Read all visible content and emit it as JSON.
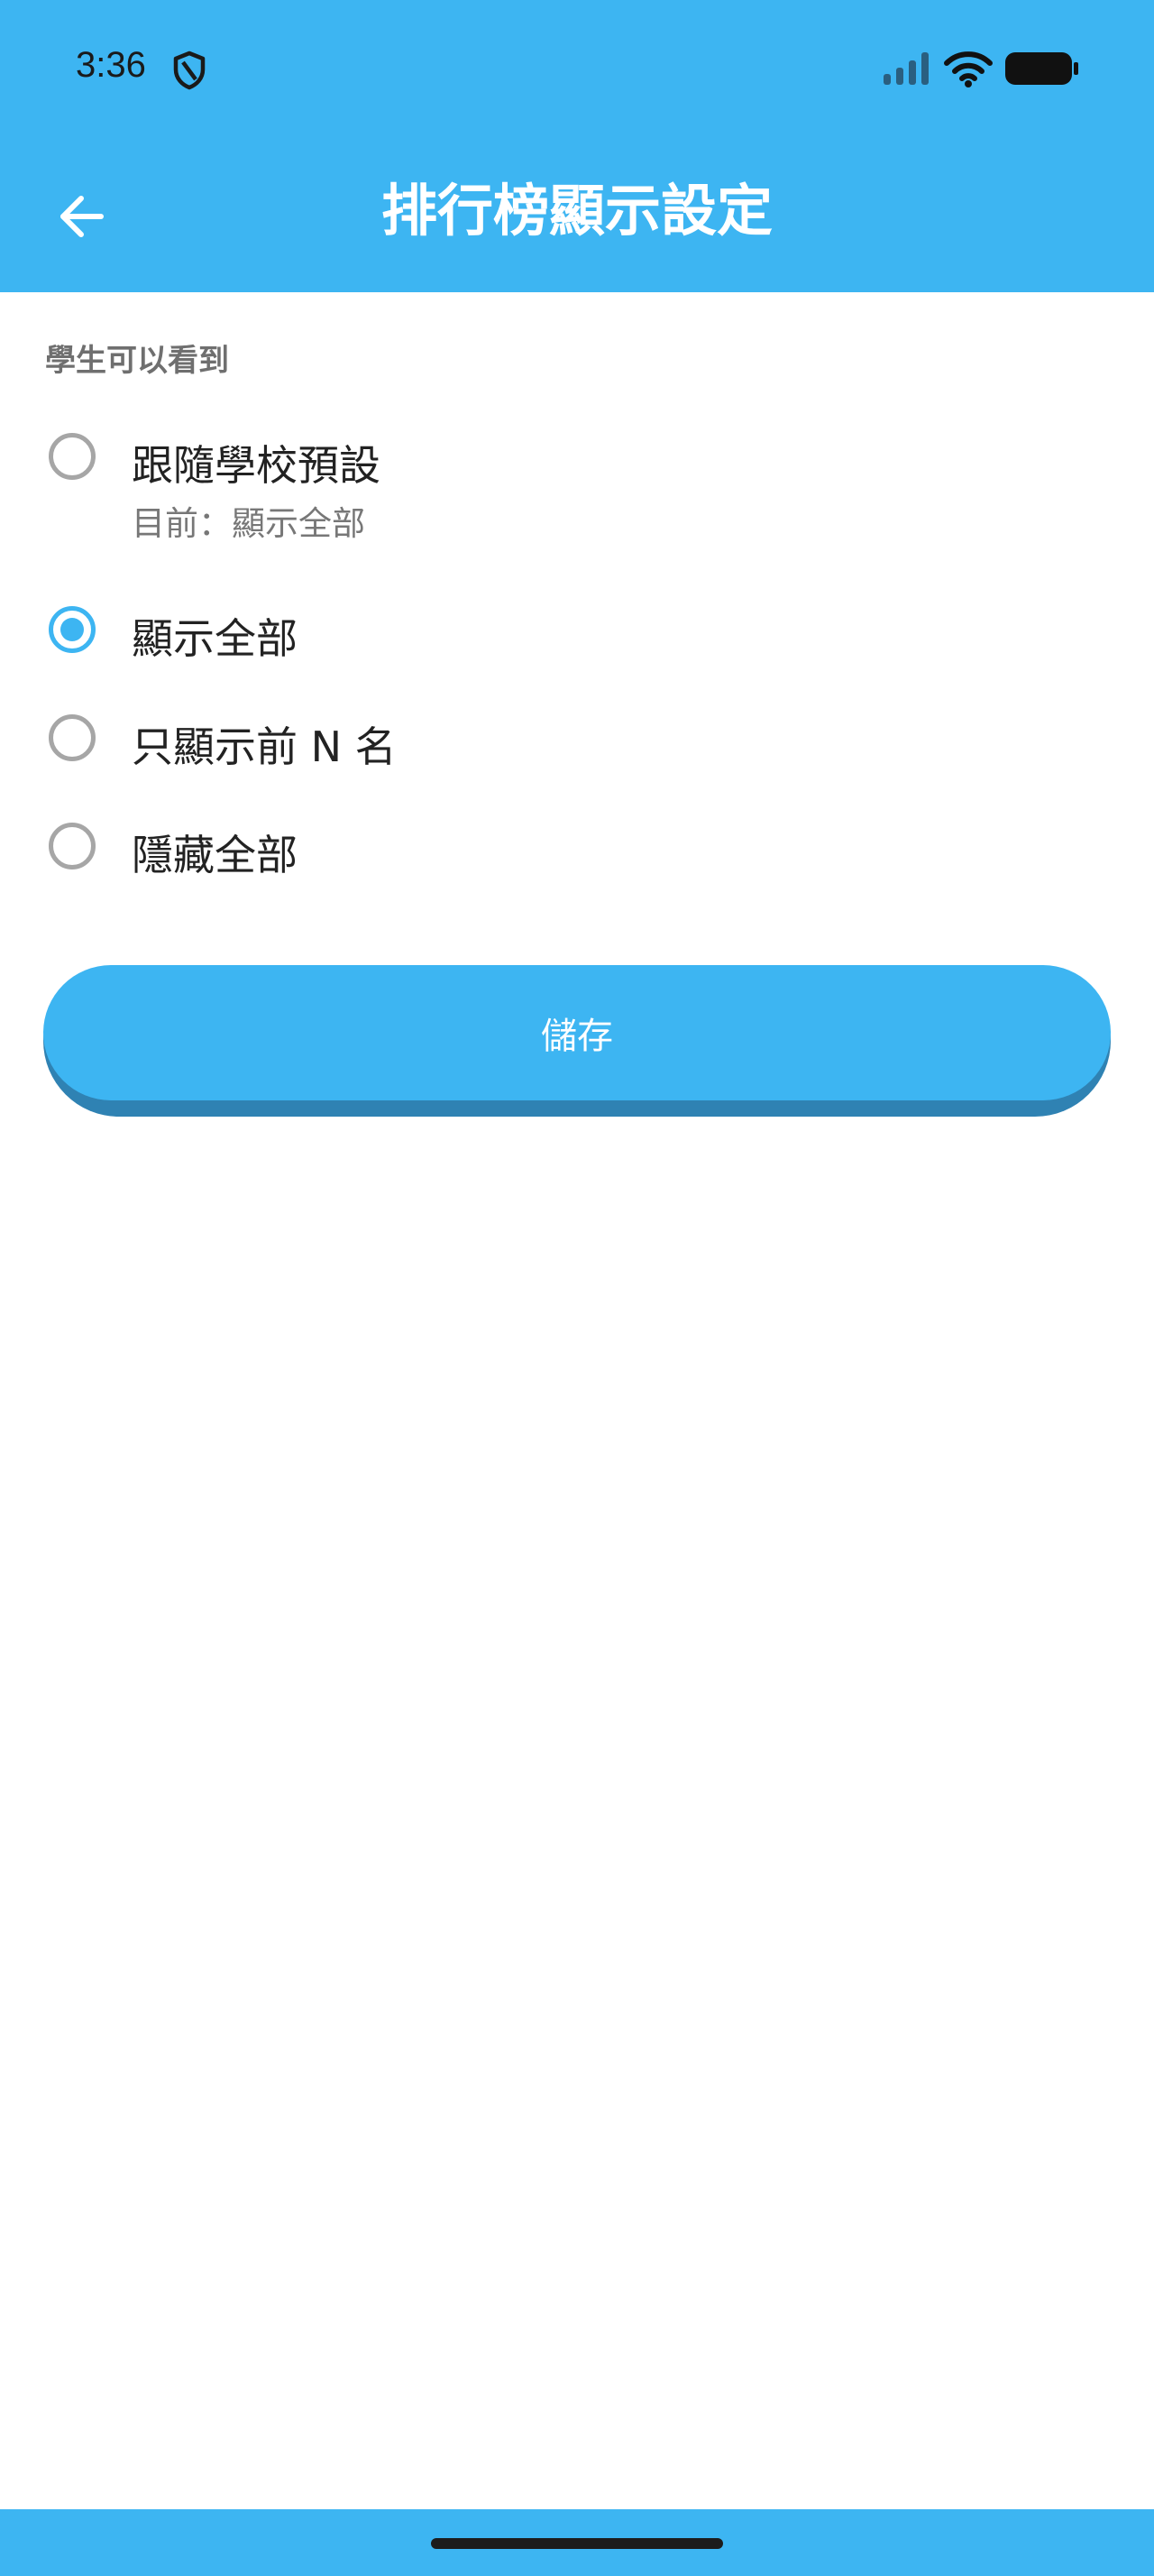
{
  "status_bar": {
    "time": "3:36",
    "icons": [
      "shield-icon",
      "signal-icon",
      "wifi-icon",
      "battery-icon"
    ]
  },
  "app_bar": {
    "title": "排行榜顯示設定",
    "back_icon": "arrow-left-icon"
  },
  "section": {
    "label": "學生可以看到"
  },
  "options": [
    {
      "label": "跟隨學校預設",
      "sublabel": "目前：顯示全部",
      "selected": false
    },
    {
      "label": "顯示全部",
      "selected": true
    },
    {
      "label": "只顯示前 N 名",
      "selected": false
    },
    {
      "label": "隱藏全部",
      "selected": false
    }
  ],
  "save_button": {
    "label": "儲存"
  },
  "colors": {
    "primary": "#3db5f2",
    "primary_dark": "#2f82b3",
    "radio_unselected": "#a6a6a6",
    "section_label": "#6f6f6f"
  }
}
